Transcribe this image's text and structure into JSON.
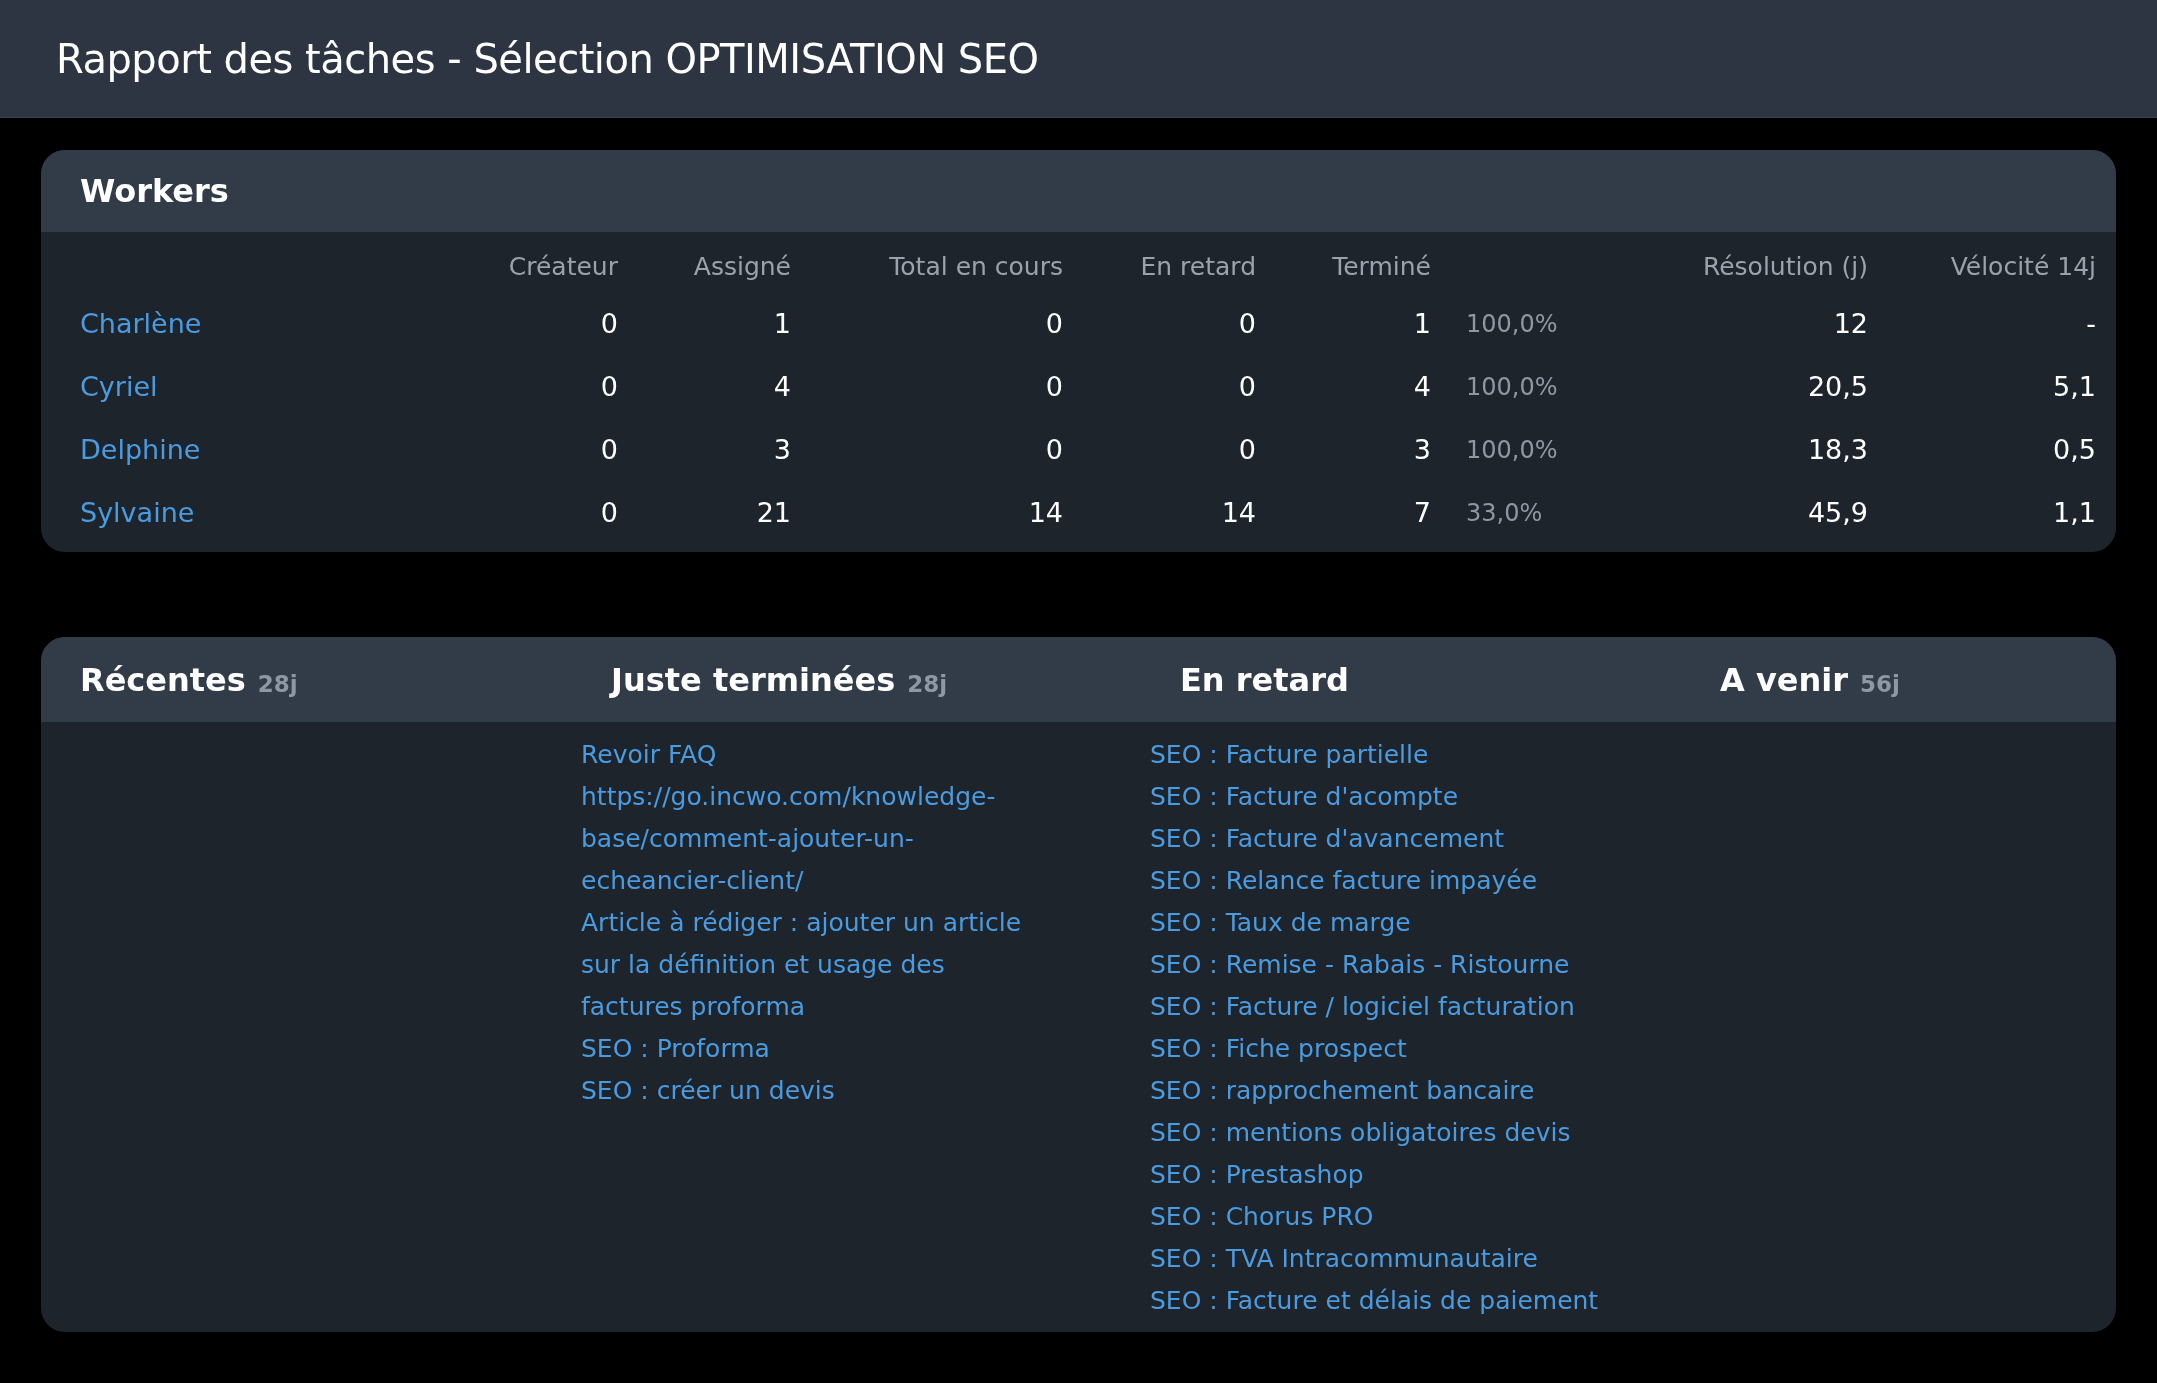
{
  "page_title": "Rapport des tâches - Sélection OPTIMISATION SEO",
  "workers": {
    "title": "Workers",
    "columns": [
      {
        "kind": "name"
      },
      {
        "kind": "number",
        "label": "Créateur"
      },
      {
        "kind": "number",
        "label": "Assigné"
      },
      {
        "kind": "number",
        "label": "Total en cours"
      },
      {
        "kind": "number",
        "label": "En retard"
      },
      {
        "kind": "number",
        "label": "Terminé"
      },
      {
        "kind": "percent"
      },
      {
        "kind": "number",
        "label": "Résolution (j)"
      },
      {
        "kind": "number",
        "label": "Vélocité 14j"
      }
    ],
    "rows": [
      {
        "cells": [
          "Charlène",
          "0",
          "1",
          "0",
          "0",
          "1",
          "100,0%",
          "12",
          "-"
        ]
      },
      {
        "cells": [
          "Cyriel",
          "0",
          "4",
          "0",
          "0",
          "4",
          "100,0%",
          "20,5",
          "5,1"
        ]
      },
      {
        "cells": [
          "Delphine",
          "0",
          "3",
          "0",
          "0",
          "3",
          "100,0%",
          "18,3",
          "0,5"
        ]
      },
      {
        "cells": [
          "Sylvaine",
          "0",
          "21",
          "14",
          "14",
          "7",
          "33,0%",
          "45,9",
          "1,1"
        ]
      }
    ]
  },
  "task_lists": [
    {
      "title": "Récentes",
      "period": "28j"
    },
    {
      "title": "Juste terminées",
      "period": "28j",
      "items": [
        "Revoir FAQ",
        "https://go.incwo.com/knowledge-base/comment-ajouter-un-echeancier-client/",
        "Article à rédiger : ajouter un article sur la définition et usage des factures proforma",
        "SEO : Proforma",
        "SEO : créer un devis"
      ]
    },
    {
      "title": "En retard",
      "items": [
        "SEO : Facture partielle",
        "SEO : Facture d'acompte",
        "SEO : Facture d'avancement",
        "SEO : Relance facture impayée",
        "SEO : Taux de marge",
        "SEO : Remise - Rabais - Ristourne",
        "SEO : Facture / logiciel facturation",
        "SEO : Fiche prospect",
        "SEO : rapprochement bancaire",
        "SEO : mentions obligatoires devis",
        "SEO : Prestashop",
        "SEO : Chorus PRO",
        "SEO : TVA Intracommunautaire",
        "SEO : Facture et délais de paiement"
      ]
    },
    {
      "title": "A venir",
      "period": "56j"
    }
  ]
}
